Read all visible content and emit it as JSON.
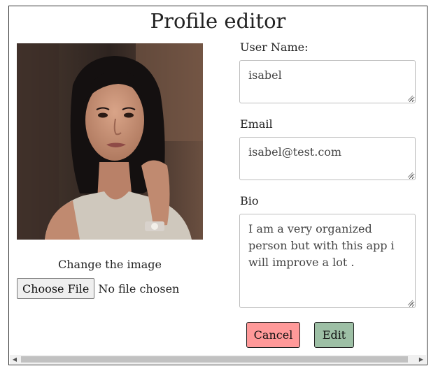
{
  "page": {
    "title": "Profile editor"
  },
  "image_panel": {
    "change_label": "Change the image",
    "choose_button": "Choose File",
    "file_status": "No file chosen"
  },
  "form": {
    "username": {
      "label": "User Name:",
      "value": "isabel"
    },
    "email": {
      "label": "Email",
      "value": "isabel@test.com"
    },
    "bio": {
      "label": "Bio",
      "value": "I am a very organized person but with this app i will improve a lot ."
    }
  },
  "actions": {
    "cancel_label": "Cancel",
    "edit_label": "Edit"
  },
  "colors": {
    "cancel_bg": "#ff9999",
    "edit_bg": "#9dbfa5"
  }
}
